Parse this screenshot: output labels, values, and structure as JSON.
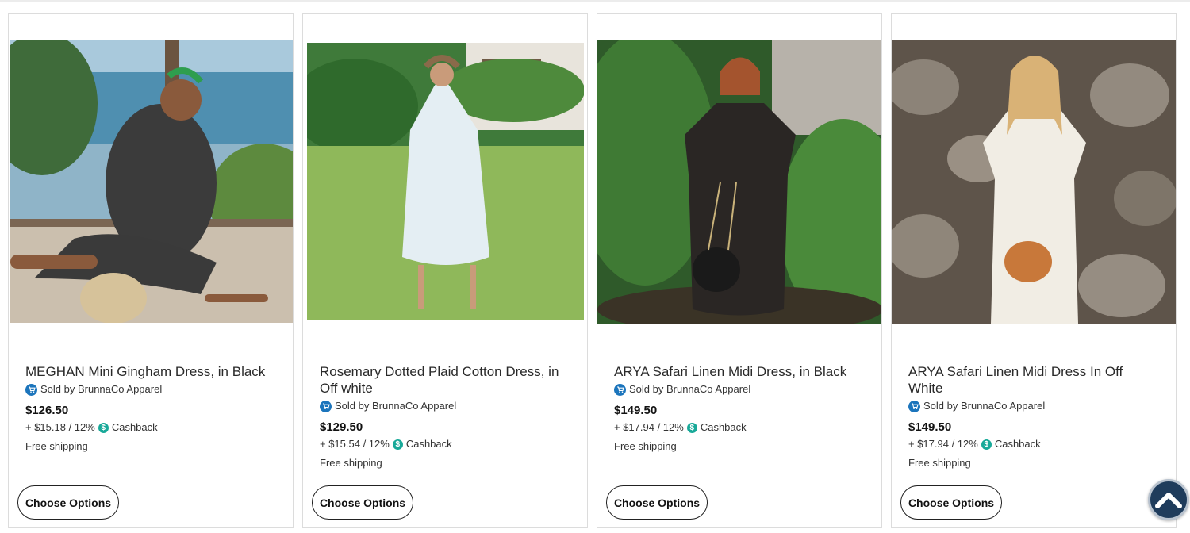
{
  "products": [
    {
      "title": "MEGHAN Mini Gingham Dress, in Black",
      "seller": "Sold by BrunnaCo Apparel",
      "price": "$126.50",
      "cashback_amount": "+ $15.18 / 12%",
      "cashback_label": "Cashback",
      "shipping": "Free shipping",
      "button_label": "Choose Options"
    },
    {
      "title": "Rosemary Dotted Plaid Cotton Dress, in Off white",
      "seller": "Sold by BrunnaCo Apparel",
      "price": "$129.50",
      "cashback_amount": "+ $15.54 / 12%",
      "cashback_label": "Cashback",
      "shipping": "Free shipping",
      "button_label": "Choose Options"
    },
    {
      "title": "ARYA Safari Linen Midi Dress, in Black",
      "seller": "Sold by BrunnaCo Apparel",
      "price": "$149.50",
      "cashback_amount": "+ $17.94 / 12%",
      "cashback_label": "Cashback",
      "shipping": "Free shipping",
      "button_label": "Choose Options"
    },
    {
      "title": "ARYA Safari Linen Midi Dress In Off White",
      "seller": "Sold by BrunnaCo Apparel",
      "price": "$149.50",
      "cashback_amount": "+ $17.94 / 12%",
      "cashback_label": "Cashback",
      "shipping": "Free shipping",
      "button_label": "Choose Options"
    }
  ],
  "icons": {
    "seller": "shopping-cart-icon",
    "cashback": "dollar-icon",
    "scroll_top": "chevron-up-icon"
  },
  "colors": {
    "seller_icon": "#1c75bc",
    "cashback_icon": "#18a999",
    "scroll_top_button": "#1f3c5c"
  }
}
